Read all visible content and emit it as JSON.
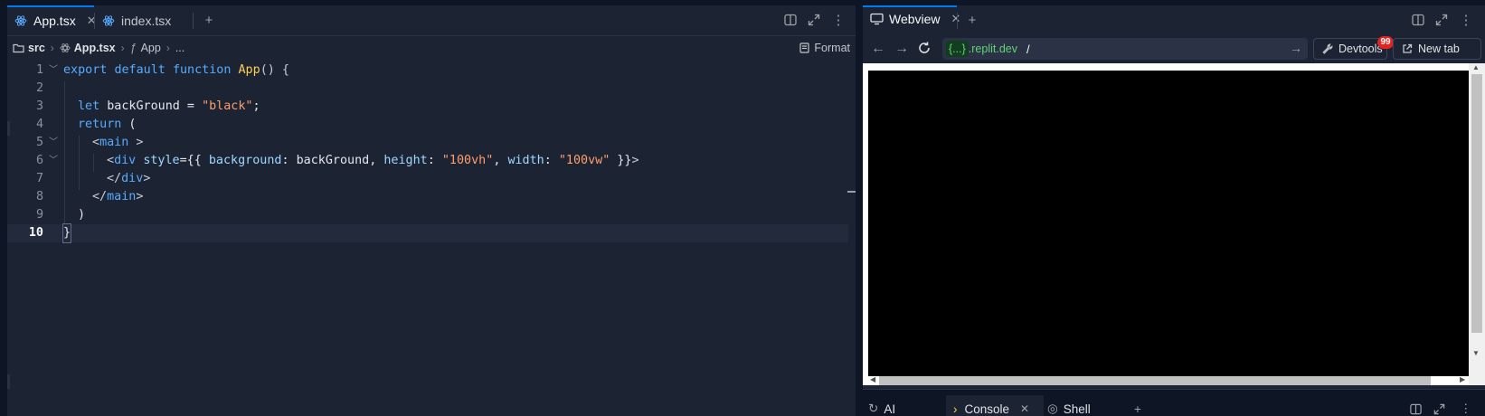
{
  "editor": {
    "tabs": [
      {
        "label": "App.tsx",
        "active": true
      },
      {
        "label": "index.tsx",
        "active": false
      }
    ],
    "breadcrumb": {
      "folder": "src",
      "file": "App.tsx",
      "symbol": "App",
      "more": "..."
    },
    "format_label": "Format",
    "lines": [
      {
        "n": "1"
      },
      {
        "n": "2"
      },
      {
        "n": "3"
      },
      {
        "n": "4"
      },
      {
        "n": "5"
      },
      {
        "n": "6"
      },
      {
        "n": "7"
      },
      {
        "n": "8"
      },
      {
        "n": "9"
      },
      {
        "n": "10"
      }
    ],
    "code": {
      "l1": {
        "kw1": "export",
        "kw2": "default",
        "kw3": "function",
        "fn": "App",
        "rest": "() {"
      },
      "l3": {
        "kw": "let",
        "name": "backGround",
        "eq": " = ",
        "str": "\"black\"",
        "end": ";"
      },
      "l4": {
        "kw": "return",
        "rest": " ("
      },
      "l5": {
        "open": "<",
        "tag": "main",
        "close": " >"
      },
      "l6": {
        "open": "<",
        "tag": "div",
        "attr": "style",
        "eqb": "={{ ",
        "p1": "background",
        "c1": ": ",
        "v1": "backGround",
        "sep1": ", ",
        "p2": "height",
        "c2": ": ",
        "v2": "\"100vh\"",
        "sep2": ", ",
        "p3": "width",
        "c3": ": ",
        "v3": "\"100vw\"",
        "endb": " }}",
        "gt": ">"
      },
      "l7": {
        "open": "</",
        "tag": "div",
        "gt": ">"
      },
      "l8": {
        "open": "</",
        "tag": "main",
        "gt": ">"
      },
      "l9": {
        "text": ")"
      },
      "l10": {
        "text": "}"
      }
    }
  },
  "webview": {
    "tab_label": "Webview",
    "url": {
      "domain_token": "{...}",
      "host": ".replit.dev",
      "path": "/"
    },
    "devtools_label": "Devtools",
    "devtools_badge": "99",
    "new_tab_label": "New tab",
    "page_background": "#000000"
  },
  "bottom_tabs": [
    {
      "label": "AI"
    },
    {
      "label": "Console"
    },
    {
      "label": "Shell"
    }
  ],
  "colors": {
    "accent": "#0079f2",
    "panel": "#1c2333",
    "background": "#0e1525"
  }
}
